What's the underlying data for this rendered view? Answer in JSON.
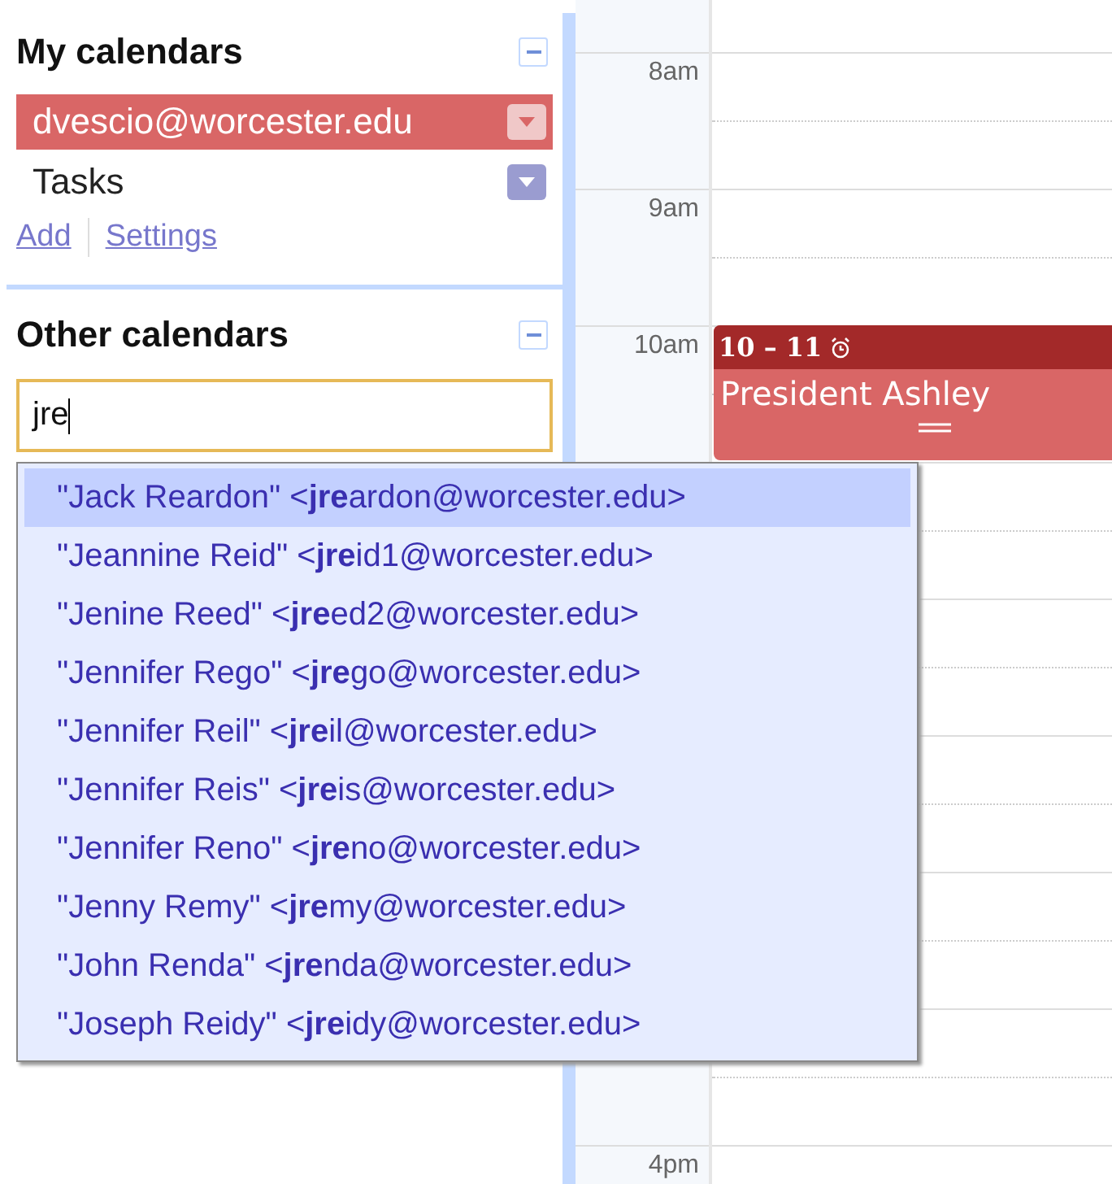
{
  "my_calendars": {
    "title": "My calendars",
    "items": [
      {
        "name": "dvescio@worcester.edu",
        "color": "#d96666",
        "selected": true
      },
      {
        "name": "Tasks",
        "color": "#9a9cd0",
        "selected": false
      }
    ],
    "links": [
      "Add",
      "Settings"
    ]
  },
  "other_calendars": {
    "title": "Other calendars",
    "search": {
      "value": "jre"
    }
  },
  "suggestions": [
    {
      "text": "\"Jack Reardon\" <**jre**ardon@worcester.edu>",
      "selected": true
    },
    {
      "text": "\"Jeannine Reid\" <**jre**id1@worcester.edu>",
      "selected": false
    },
    {
      "text": "\"Jenine Reed\" <**jre**ed2@worcester.edu>",
      "selected": false
    },
    {
      "text": "\"Jennifer Rego\" <**jre**go@worcester.edu>",
      "selected": false
    },
    {
      "text": "\"Jennifer Reil\" <**jre**il@worcester.edu>",
      "selected": false
    },
    {
      "text": "\"Jennifer Reis\" <**jre**is@worcester.edu>",
      "selected": false
    },
    {
      "text": "\"Jennifer Reno\" <**jre**no@worcester.edu>",
      "selected": false
    },
    {
      "text": "\"Jenny Remy\" <**jre**my@worcester.edu>",
      "selected": false
    },
    {
      "text": "\"John Renda\" <**jre**nda@worcester.edu>",
      "selected": false
    },
    {
      "text": "\"Joseph Reidy\" <**jre**idy@worcester.edu>",
      "selected": false
    }
  ],
  "time_labels": [
    {
      "label": "8am"
    },
    {
      "label": "9am"
    },
    {
      "label": "10am"
    },
    {
      "label": "4pm"
    }
  ],
  "event": {
    "time": "10 – 11",
    "title": "President Ashley",
    "reminder": true
  }
}
